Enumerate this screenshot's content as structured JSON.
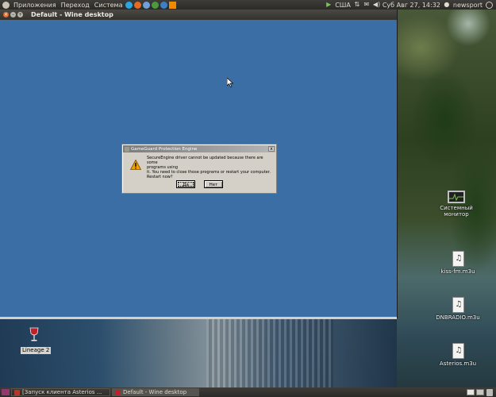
{
  "top_panel": {
    "menus": [
      "Приложения",
      "Переход",
      "Система"
    ],
    "keyboard_layout": "США",
    "datetime": "Суб Авг 27, 14:32",
    "user": "newsport"
  },
  "wine_window": {
    "title": "Default - Wine desktop"
  },
  "dialog": {
    "title": "GameGuard Protection Engine",
    "message_lines": [
      "SecureEngine driver cannot be updated because there are some",
      "programs using",
      "it. You need to close those programs or restart your computer.",
      "Restart now?"
    ],
    "yes_label": "Да",
    "no_label": "Нет"
  },
  "desktop_icons": {
    "system_monitor_line1": "Системный",
    "system_monitor_line2": "монитор",
    "kiss_fm": "kiss-fm.m3u",
    "dnbradio": "DNBRADIO.m3u",
    "asterios": "Asterios.m3u",
    "lineage": "Lineage 2"
  },
  "taskbar": {
    "tasks": [
      "[Запуск клиента Asterios ...",
      "Default - Wine desktop"
    ]
  },
  "colors": {
    "wine_desktop_bg": "#3a6ea5",
    "panel_bg": "#33322e",
    "close_button": "#e36b2d"
  }
}
